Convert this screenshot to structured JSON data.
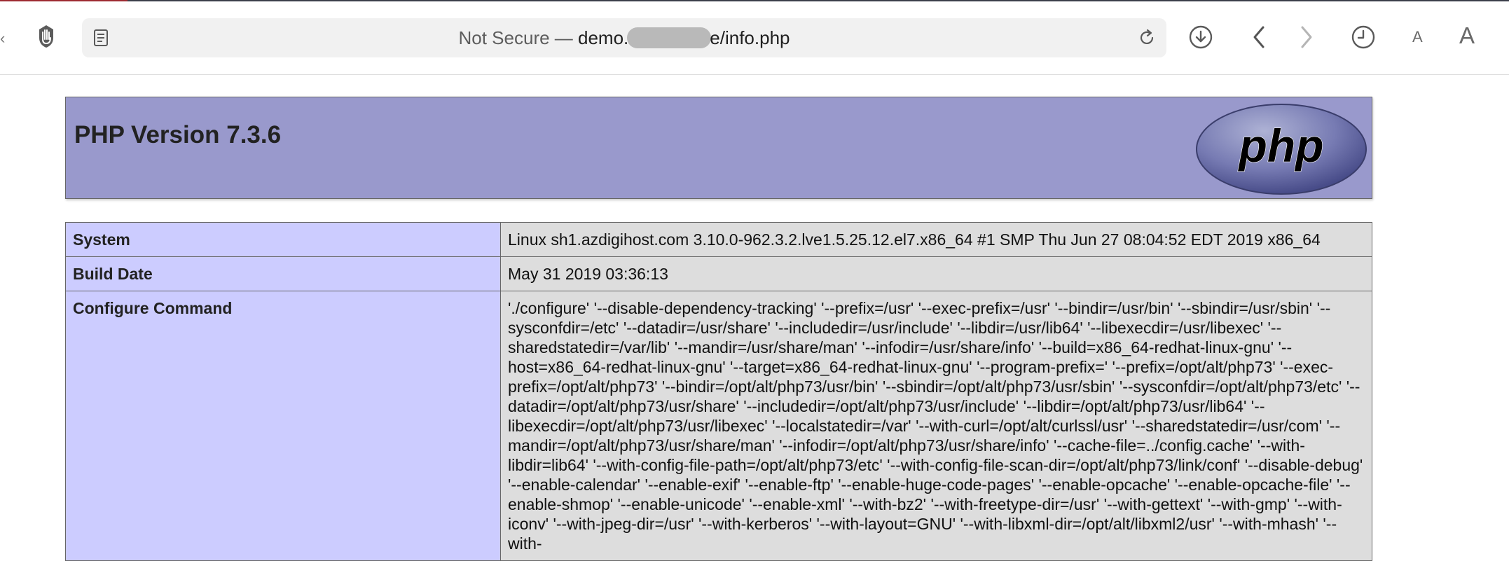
{
  "browser": {
    "address_bar": {
      "prefix": "Not Secure — ",
      "domain_start": "demo.",
      "domain_end": "e",
      "path": "/info.php"
    },
    "font_small_label": "A",
    "font_large_label": "A",
    "icons": [
      "reader-icon",
      "reload-icon",
      "download-icon",
      "back-icon",
      "forward-icon",
      "history-icon",
      "hand-icon"
    ]
  },
  "phpinfo": {
    "title": "PHP Version 7.3.6",
    "logo_text": "php",
    "colors": {
      "header_bg": "#9999cc",
      "key_bg": "#ccccff",
      "value_bg": "#dddddd"
    },
    "rows": [
      {
        "key": "System",
        "value": "Linux sh1.azdigihost.com 3.10.0-962.3.2.lve1.5.25.12.el7.x86_64 #1 SMP Thu Jun 27 08:04:52 EDT 2019 x86_64"
      },
      {
        "key": "Build Date",
        "value": "May 31 2019 03:36:13"
      },
      {
        "key": "Configure Command",
        "value": "'./configure' '--disable-dependency-tracking' '--prefix=/usr' '--exec-prefix=/usr' '--bindir=/usr/bin' '--sbindir=/usr/sbin' '--sysconfdir=/etc' '--datadir=/usr/share' '--includedir=/usr/include' '--libdir=/usr/lib64' '--libexecdir=/usr/libexec' '--sharedstatedir=/var/lib' '--mandir=/usr/share/man' '--infodir=/usr/share/info' '--build=x86_64-redhat-linux-gnu' '--host=x86_64-redhat-linux-gnu' '--target=x86_64-redhat-linux-gnu' '--program-prefix=' '--prefix=/opt/alt/php73' '--exec-prefix=/opt/alt/php73' '--bindir=/opt/alt/php73/usr/bin' '--sbindir=/opt/alt/php73/usr/sbin' '--sysconfdir=/opt/alt/php73/etc' '--datadir=/opt/alt/php73/usr/share' '--includedir=/opt/alt/php73/usr/include' '--libdir=/opt/alt/php73/usr/lib64' '--libexecdir=/opt/alt/php73/usr/libexec' '--localstatedir=/var' '--with-curl=/opt/alt/curlssl/usr' '--sharedstatedir=/usr/com' '--mandir=/opt/alt/php73/usr/share/man' '--infodir=/opt/alt/php73/usr/share/info' '--cache-file=../config.cache' '--with-libdir=lib64' '--with-config-file-path=/opt/alt/php73/etc' '--with-config-file-scan-dir=/opt/alt/php73/link/conf' '--disable-debug' '--enable-calendar' '--enable-exif' '--enable-ftp' '--enable-huge-code-pages' '--enable-opcache' '--enable-opcache-file' '--enable-shmop' '--enable-unicode' '--enable-xml' '--with-bz2' '--with-freetype-dir=/usr' '--with-gettext' '--with-gmp' '--with-iconv' '--with-jpeg-dir=/usr' '--with-kerberos' '--with-layout=GNU' '--with-libxml-dir=/opt/alt/libxml2/usr' '--with-mhash' '--with-"
      }
    ]
  }
}
